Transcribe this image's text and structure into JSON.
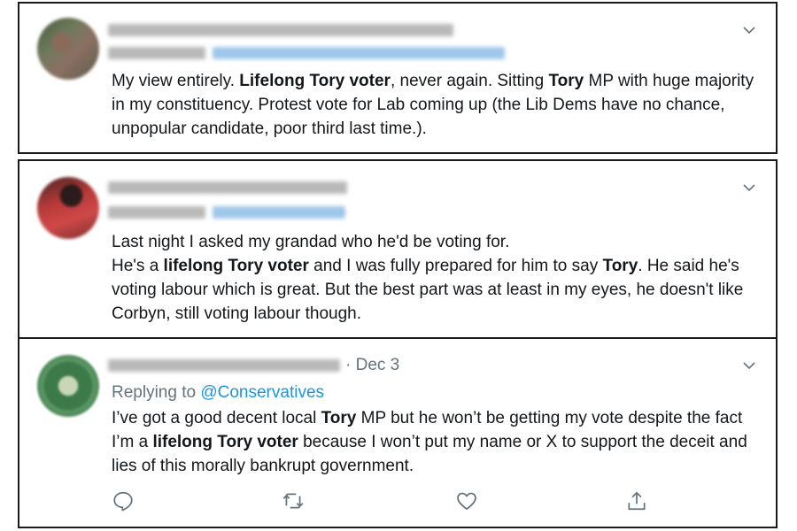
{
  "tweets": [
    {
      "text_parts": [
        {
          "t": "My view entirely. ",
          "b": false
        },
        {
          "t": "Lifelong Tory voter",
          "b": true
        },
        {
          "t": ", never again. Sitting ",
          "b": false
        },
        {
          "t": "Tory",
          "b": true
        },
        {
          "t": " MP with huge majority in my constituency. Protest vote for Lab coming up (the Lib Dems have no chance, unpopular candidate, poor third last time.).",
          "b": false
        }
      ]
    },
    {
      "paragraphs": [
        [
          {
            "t": "Last night I asked my grandad who he'd be voting for.",
            "b": false
          }
        ],
        [
          {
            "t": "He's a ",
            "b": false
          },
          {
            "t": "lifelong Tory voter",
            "b": true
          },
          {
            "t": " and I was fully prepared for him to say ",
            "b": false
          },
          {
            "t": "Tory",
            "b": true
          },
          {
            "t": ". He said he's voting labour which is great. But the best part was at least in my eyes, he doesn't like Corbyn, still voting labour though.",
            "b": false
          }
        ]
      ]
    },
    {
      "date": "· Dec 3",
      "replying_prefix": "Replying to ",
      "replying_handle": "@Conservatives",
      "text_parts": [
        {
          "t": "I’ve got a good decent local ",
          "b": false
        },
        {
          "t": "Tory",
          "b": true
        },
        {
          "t": " MP but he won’t be getting my vote despite the fact I’m a ",
          "b": false
        },
        {
          "t": "lifelong Tory voter",
          "b": true
        },
        {
          "t": " because I won’t put my name or X to support the deceit and lies of this morally bankrupt government.",
          "b": false
        }
      ],
      "actions": [
        "reply-icon",
        "retweet-icon",
        "like-icon",
        "share-icon"
      ]
    }
  ],
  "colors": {
    "link": "#1b95e0",
    "muted": "#65737e",
    "text": "#14171a",
    "border": "#1a1a1a"
  }
}
